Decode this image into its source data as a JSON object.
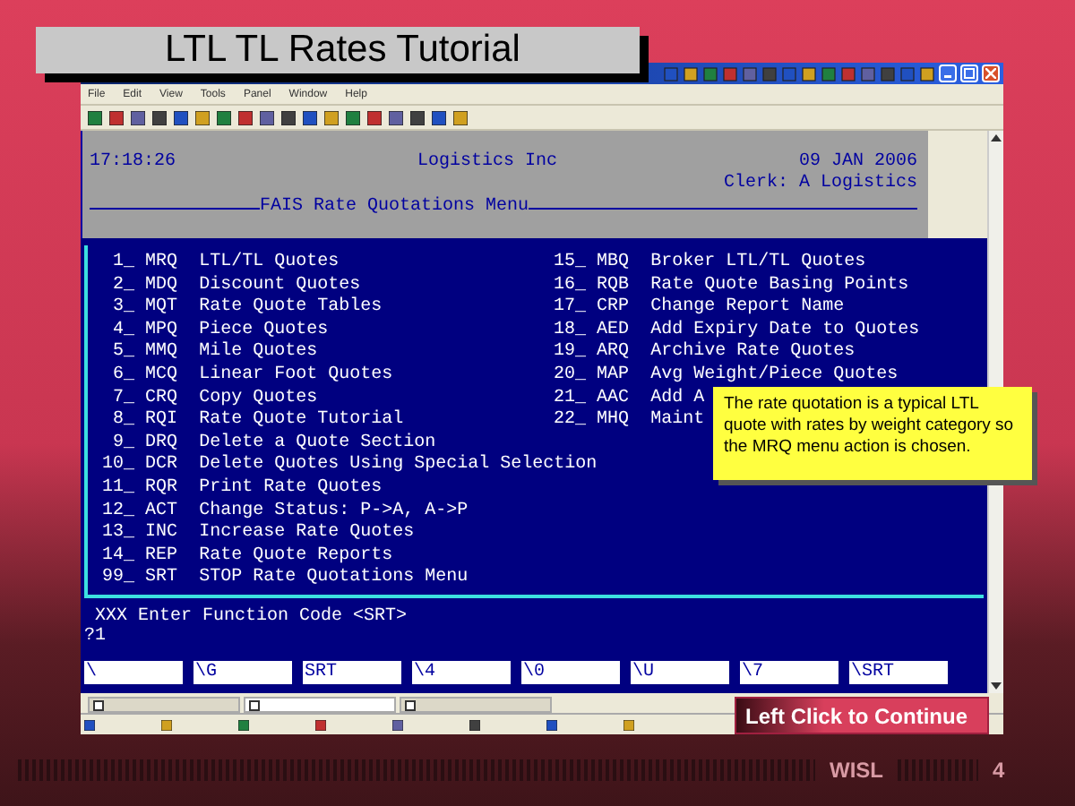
{
  "slide_title": "LTL TL Rates Tutorial",
  "window": {
    "menu": [
      "File",
      "Edit",
      "View",
      "Tools",
      "Panel",
      "Window",
      "Help"
    ]
  },
  "header": {
    "time": "17:18:26",
    "company": "Logistics Inc",
    "date": "09 JAN 2006",
    "clerk": "Clerk: A Logistics",
    "menu_title": "FAIS Rate Quotations Menu"
  },
  "menu_left": [
    {
      "number": "1_",
      "code": "MRQ",
      "label": "LTL/TL Quotes"
    },
    {
      "number": "2_",
      "code": "MDQ",
      "label": "Discount Quotes"
    },
    {
      "number": "3_",
      "code": "MQT",
      "label": "Rate Quote Tables"
    },
    {
      "number": "4_",
      "code": "MPQ",
      "label": "Piece Quotes"
    },
    {
      "number": "5_",
      "code": "MMQ",
      "label": "Mile Quotes"
    },
    {
      "number": "6_",
      "code": "MCQ",
      "label": "Linear Foot Quotes"
    },
    {
      "number": "7_",
      "code": "CRQ",
      "label": "Copy Quotes"
    },
    {
      "number": "8_",
      "code": "RQI",
      "label": "Rate Quote Tutorial"
    },
    {
      "number": "9_",
      "code": "DRQ",
      "label": "Delete a Quote Section"
    },
    {
      "number": "10_",
      "code": "DCR",
      "label": "Delete Quotes Using Special Selection"
    },
    {
      "number": "11_",
      "code": "RQR",
      "label": "Print Rate Quotes"
    },
    {
      "number": "12_",
      "code": "ACT",
      "label": "Change Status: P->A, A->P"
    },
    {
      "number": "13_",
      "code": "INC",
      "label": "Increase Rate Quotes"
    },
    {
      "number": "14_",
      "code": "REP",
      "label": "Rate Quote Reports"
    },
    {
      "number": "99_",
      "code": "SRT",
      "label": "STOP Rate Quotations Menu"
    }
  ],
  "menu_right": [
    {
      "number": "15_",
      "code": "MBQ",
      "label": "Broker LTL/TL Quotes"
    },
    {
      "number": "16_",
      "code": "RQB",
      "label": "Rate Quote Basing Points"
    },
    {
      "number": "17_",
      "code": "CRP",
      "label": "Change Report Name"
    },
    {
      "number": "18_",
      "code": "AED",
      "label": "Add Expiry Date to Quotes"
    },
    {
      "number": "19_",
      "code": "ARQ",
      "label": "Archive Rate Quotes"
    },
    {
      "number": "20_",
      "code": "MAP",
      "label": "Avg Weight/Piece Quotes"
    },
    {
      "number": "21_",
      "code": "AAC",
      "label": "Add A"
    },
    {
      "number": "22_",
      "code": "MHQ",
      "label": "Maint"
    }
  ],
  "session_tabs": [
    {
      "selected": false
    },
    {
      "selected": true
    },
    {
      "selected": false
    }
  ],
  "prompt": "XXX Enter Function Code <SRT>",
  "input": "?1",
  "function_keys": [
    "\\",
    "\\G",
    "SRT",
    "\\4",
    "\\0",
    "\\U",
    "\\7",
    "\\SRT"
  ],
  "callout": "The rate quotation is a typical LTL quote with rates by weight category so the MRQ menu action is chosen.",
  "continue_button": "Left Click to Continue",
  "footer": {
    "brand": "WISL",
    "page": "4"
  }
}
